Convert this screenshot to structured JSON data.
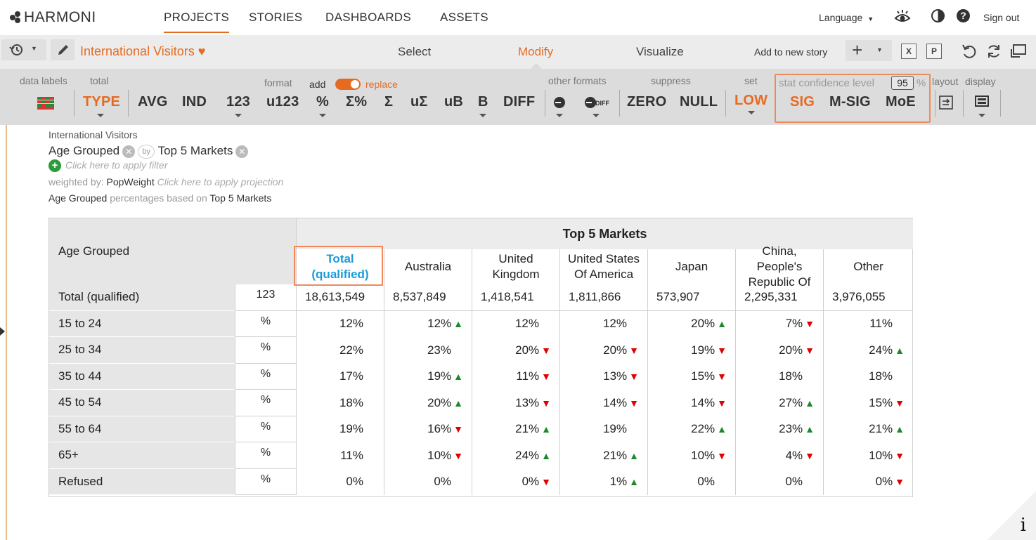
{
  "app": {
    "logo_text": "HARMONI"
  },
  "nav": {
    "tabs": [
      "PROJECTS",
      "STORIES",
      "DASHBOARDS",
      "ASSETS"
    ],
    "language_label": "Language",
    "signout_label": "Sign out"
  },
  "toolbar": {
    "title": "International Visitors",
    "modes": [
      "Select",
      "Modify",
      "Visualize"
    ],
    "add_story_label": "Add to new story"
  },
  "ribbon": {
    "labels": {
      "data_labels": "data labels",
      "total": "total",
      "format": "format",
      "add": "add",
      "replace": "replace",
      "other_formats": "other formats",
      "suppress": "suppress",
      "set": "set",
      "stat_conf": "stat confidence level",
      "conf_value": "95",
      "pct": "%",
      "layout": "layout",
      "display": "display"
    },
    "buttons": {
      "type": "TYPE",
      "avg": "AVG",
      "ind": "IND",
      "n123": "123",
      "u123": "u123",
      "pct": "%",
      "sum_pct": "Σ%",
      "sum": "Σ",
      "usum": "uΣ",
      "ub": "uB",
      "b": "B",
      "diff": "DIFF",
      "zero": "ZERO",
      "null": "NULL",
      "low": "LOW",
      "sig": "SIG",
      "msig": "M-SIG",
      "moe": "MoE"
    },
    "accent_color": "#e56b22"
  },
  "meta": {
    "dataset": "International Visitors",
    "row_var": "Age Grouped",
    "col_var": "Top 5 Markets",
    "filter_hint": "Click here to apply filter",
    "weighted_prefix": "weighted by:",
    "weight_name": "PopWeight",
    "projection_hint": "Click here to apply projection",
    "pct_row_var": "Age Grouped",
    "pct_text": "percentages based on",
    "pct_col_var": "Top 5 Markets"
  },
  "table": {
    "row_header": "Age Grouped",
    "banner": "Top 5 Markets",
    "columns": [
      "Total (qualified)",
      "Australia",
      "United Kingdom",
      "United States Of America",
      "Japan",
      "China, People's Republic Of",
      "Other"
    ],
    "rows": [
      {
        "label": "Total (qualified)",
        "fmt": "123",
        "cells": [
          [
            "18,613,549",
            ""
          ],
          [
            "8,537,849",
            ""
          ],
          [
            "1,418,541",
            ""
          ],
          [
            "1,811,866",
            ""
          ],
          [
            "573,907",
            ""
          ],
          [
            "2,295,331",
            ""
          ],
          [
            "3,976,055",
            ""
          ]
        ]
      },
      {
        "label": "15 to 24",
        "fmt": "%",
        "cells": [
          [
            "12%",
            ""
          ],
          [
            "12%",
            "up"
          ],
          [
            "12%",
            ""
          ],
          [
            "12%",
            ""
          ],
          [
            "20%",
            "up"
          ],
          [
            "7%",
            "down"
          ],
          [
            "11%",
            ""
          ]
        ]
      },
      {
        "label": "25 to 34",
        "fmt": "%",
        "cells": [
          [
            "22%",
            ""
          ],
          [
            "23%",
            ""
          ],
          [
            "20%",
            "down"
          ],
          [
            "20%",
            "down"
          ],
          [
            "19%",
            "down"
          ],
          [
            "20%",
            "down"
          ],
          [
            "24%",
            "up"
          ]
        ]
      },
      {
        "label": "35 to 44",
        "fmt": "%",
        "cells": [
          [
            "17%",
            ""
          ],
          [
            "19%",
            "up"
          ],
          [
            "11%",
            "down"
          ],
          [
            "13%",
            "down"
          ],
          [
            "15%",
            "down"
          ],
          [
            "18%",
            ""
          ],
          [
            "18%",
            ""
          ]
        ]
      },
      {
        "label": "45 to 54",
        "fmt": "%",
        "cells": [
          [
            "18%",
            ""
          ],
          [
            "20%",
            "up"
          ],
          [
            "13%",
            "down"
          ],
          [
            "14%",
            "down"
          ],
          [
            "14%",
            "down"
          ],
          [
            "27%",
            "up"
          ],
          [
            "15%",
            "down"
          ]
        ]
      },
      {
        "label": "55 to 64",
        "fmt": "%",
        "cells": [
          [
            "19%",
            ""
          ],
          [
            "16%",
            "down"
          ],
          [
            "21%",
            "up"
          ],
          [
            "19%",
            ""
          ],
          [
            "22%",
            "up"
          ],
          [
            "23%",
            "up"
          ],
          [
            "21%",
            "up"
          ]
        ]
      },
      {
        "label": "65+",
        "fmt": "%",
        "cells": [
          [
            "11%",
            ""
          ],
          [
            "10%",
            "down"
          ],
          [
            "24%",
            "up"
          ],
          [
            "21%",
            "up"
          ],
          [
            "10%",
            "down"
          ],
          [
            "4%",
            "down"
          ],
          [
            "10%",
            "down"
          ]
        ]
      },
      {
        "label": "Refused",
        "fmt": "%",
        "cells": [
          [
            "0%",
            ""
          ],
          [
            "0%",
            ""
          ],
          [
            "0%",
            "down"
          ],
          [
            "1%",
            "up"
          ],
          [
            "0%",
            ""
          ],
          [
            "0%",
            ""
          ],
          [
            "0%",
            "down"
          ]
        ]
      }
    ],
    "up_color": "#1a8a2a",
    "down_color": "#e00000",
    "total_col_color": "#1a9bd7"
  }
}
